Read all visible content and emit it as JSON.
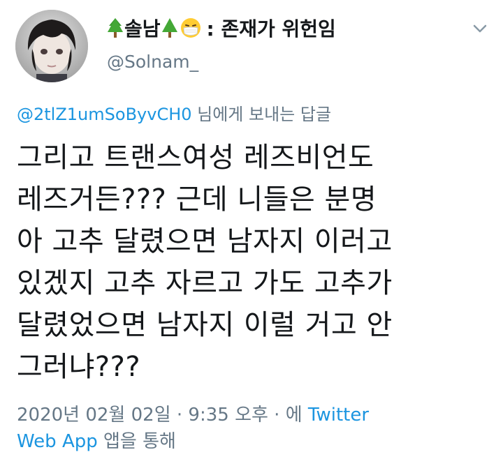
{
  "user": {
    "display_name_left": "솔남",
    "display_name_right": ": 존재가 위헌임",
    "handle": "@Solnam_",
    "avatar_icon": "doll-avatar",
    "emoji_1": "evergreen-tree",
    "emoji_2": "evergreen-tree",
    "emoji_3": "face-with-medical-mask"
  },
  "menu": {
    "icon": "chevron-down-icon"
  },
  "reply": {
    "mention": "@2tlZ1umSoByvCH0",
    "suffix": " 님에게 보내는 답글"
  },
  "tweet": {
    "lines": [
      "그리고 트랜스여성 레즈비언도",
      "레즈거든??? 근데 니들은 분명",
      "아 고추 달렸으면 남자지 이러고",
      "있겠지 고추 자르고 가도 고추가",
      "달렸었으면 남자지 이럴 거고 안",
      "그러냐???"
    ]
  },
  "meta": {
    "timestamp": "2020년 02월 02일 · 9:35 오후 · 에 ",
    "app_name_1": "Twitter",
    "app_name_2": "Web App",
    "suffix": " 앱을 통해"
  },
  "colors": {
    "text": "#14171a",
    "secondary": "#657786",
    "link": "#1b95e0"
  }
}
